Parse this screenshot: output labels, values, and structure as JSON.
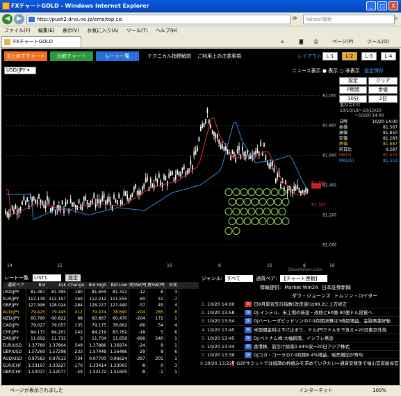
{
  "window": {
    "title": "FXチャートGOLD - Windows Internet Explorer",
    "minimize": "_",
    "maximize": "□",
    "close": "X"
  },
  "address": {
    "url": "http://push2.drvs.ne.jp/emo/top.cei",
    "search_placeholder": "Yahoo!検索"
  },
  "menu": [
    "ファイル(F)",
    "編集(E)",
    "表示(V)",
    "お気に入り(A)",
    "ツール(T)",
    "ヘルプ(H)"
  ],
  "tab": {
    "label": "FXチャートGOLD"
  },
  "toolbar": {
    "page": "ページ(P)",
    "tools": "ツール(O)"
  },
  "appnav": {
    "b1": "まとめてチャート",
    "b2": "比較チャート",
    "b3": "レート一覧",
    "t1": "テクニカル指標解説",
    "t2": "ご利用上の注意事項",
    "layout": "レイアウト",
    "l1": "L-1",
    "l2": "L-2",
    "l3": "L-3",
    "l4": "L-4",
    "c1": "#f07020",
    "c2": "#2a9a3a",
    "c3": "#2a6fd8"
  },
  "chart": {
    "symbol": "USD/JPY",
    "news_display": "ニュース表示",
    "show": "表示",
    "hide": "非表示",
    "settings_save": "設定保存",
    "yticks": [
      "82.000",
      "81.800",
      "81.600",
      "81.400",
      "81.200",
      "81.000"
    ],
    "xticks": [
      "14",
      "15",
      "16",
      "8",
      "16",
      "8",
      "16"
    ],
    "price_upper": "81.395",
    "price_lower": "81.307",
    "watermark": "DreamVisor.com"
  },
  "side": {
    "settings": "設定",
    "clear": "クリア",
    "period": "P期間",
    "footstep": "歩値",
    "interval": "10分",
    "count": "2日",
    "heavy": "重ね合わせ",
    "from": "10/10/18〜10/10/20",
    "to": "〜10/20 14:00",
    "rows": [
      {
        "k": "日時",
        "v": "10/20 14:00"
      },
      {
        "k": "始値",
        "v": "81.567"
      },
      {
        "k": "高値",
        "v": "81.850"
      },
      {
        "k": "安値",
        "v": "81.283"
      },
      {
        "k": "終値",
        "v": "81.887"
      },
      {
        "k": "前日比",
        "v": "0.287"
      },
      {
        "k": "MA(5)",
        "v": "81.429"
      },
      {
        "k": "MA(25)",
        "v": "81.553"
      }
    ]
  },
  "rates": {
    "title": "レート一覧",
    "list": "LIST1",
    "settings": "設定",
    "columns": [
      "通貨ペア",
      "Bid",
      "Ask",
      "Change",
      "Bid High",
      "Bid Low",
      "売SW(円)",
      "買SW(円)",
      "日初"
    ],
    "rows": [
      [
        "USD/JPY",
        "81.387",
        "81.395",
        "-180",
        "81.659",
        "81.322",
        "-12",
        "6",
        "3"
      ],
      [
        "EUR/JPY",
        "112.139",
        "112.157",
        "160",
        "112.212",
        "111.555",
        "-60",
        "51",
        "-7"
      ],
      [
        "GBP/JPY",
        "127.996",
        "128.024",
        "-284",
        "128.227",
        "127.440",
        "-57",
        "45",
        "4"
      ],
      [
        "AUD/JPY",
        "79.425",
        "79.445",
        "412",
        "79.474",
        "78.690",
        "-204",
        "285",
        "8"
      ],
      [
        "NZD/JPY",
        "60.790",
        "60.822",
        "98",
        "60.867",
        "60.470",
        "-204",
        "172",
        "1"
      ],
      [
        "CAD/JPY",
        "79.027",
        "79.057",
        "135",
        "79.175",
        "78.662",
        "-66",
        "54",
        "4"
      ],
      [
        "CHF/JPY",
        "84.171",
        "84.201",
        "242",
        "84.219",
        "83.762",
        "-18",
        "5",
        "6"
      ],
      [
        "ZAR/JPY",
        "11.692",
        "11.732",
        "3",
        "11.704",
        "11.659",
        "-666",
        "540",
        "1"
      ],
      [
        "EUR/USD",
        "1.37780",
        "1.37804",
        "549",
        "1.37886",
        "1.36974",
        "-24",
        "9",
        "1"
      ],
      [
        "GBP/USD",
        "1.57260",
        "1.57298",
        "233",
        "1.57448",
        "1.56486",
        "-29",
        "8",
        "6"
      ],
      [
        "AUD/USD",
        "0.97583",
        "0.97613",
        "734",
        "0.97700",
        "0.96624",
        "-297",
        "201",
        "1"
      ],
      [
        "EUR/CHF",
        "1.33197",
        "1.33227",
        "-170",
        "1.33414",
        "1.33091",
        "-8",
        "0",
        "3"
      ],
      [
        "GBP/CHF",
        "1.52037",
        "1.52077",
        "-59",
        "1.52172",
        "1.51605",
        "-8",
        "-1",
        "1"
      ]
    ]
  },
  "news": {
    "genre": "ジャンル:",
    "genre_value": "すべて",
    "pair": "通貨ペア:",
    "pair_value": "【チャート連動】",
    "provider": "情報提供:",
    "providers": [
      "Market Win24",
      "日本証券新聞",
      "ダウ・ジョーンズ",
      "トムソン・ロイター"
    ],
    "items": [
      {
        "n": "1.",
        "time": "10/20 14:00",
        "src": "日",
        "text": "日8月景気先行指数(改定値)は99.2に上方修正"
      },
      {
        "n": "2.",
        "time": "10/20 13:58",
        "src": "DJ",
        "text": "DJ-インテル、米工場の新設・改修に60億-80億ドル投資へ"
      },
      {
        "n": "3.",
        "time": "10/20 13:54",
        "src": "DJ",
        "text": "DJハーレーダビッドソンの7-9月期決算は3倍超増益、金融事業好転"
      },
      {
        "n": "4.",
        "time": "10/20 13:45",
        "src": "M",
        "text": "米国債金利は下げ止まり、ドル/円でドルを下支え=20日東京外為"
      },
      {
        "n": "5.",
        "time": "10/20 13:45",
        "src": "DJ",
        "text": "DJ-ベトナム株:大幅続落、インフレ懸念"
      },
      {
        "n": "6.",
        "time": "10/20 13:44",
        "src": "M",
        "text": "香港株、前引け続落0.64%安=20日アジア株式"
      },
      {
        "n": "7.",
        "time": "10/20 13:39",
        "src": "DJ",
        "text": "DJコカ・コーラの7-9月期8.4%増益、販売増加が寄与"
      },
      {
        "n": "8.",
        "time": "10/20 13:22",
        "src": "R",
        "text": "G20サミットでは協調の枠組みを求めていきたい=通貨安競争で福山官房副長官(ロイター)"
      }
    ]
  },
  "status": {
    "text": "ページが表示されました",
    "zone": "インターネット",
    "zoom": "100%"
  },
  "chart_data": {
    "type": "line",
    "y_axis_ticks": [
      82.0,
      81.8,
      81.6,
      81.4,
      81.2,
      81.0
    ],
    "ylim": [
      80.9,
      82.1
    ],
    "x_tick_labels": [
      "14",
      "15",
      "16",
      "8",
      "16",
      "8",
      "16"
    ],
    "series": [],
    "current_bid": 81.395,
    "current_ask": 81.307
  }
}
